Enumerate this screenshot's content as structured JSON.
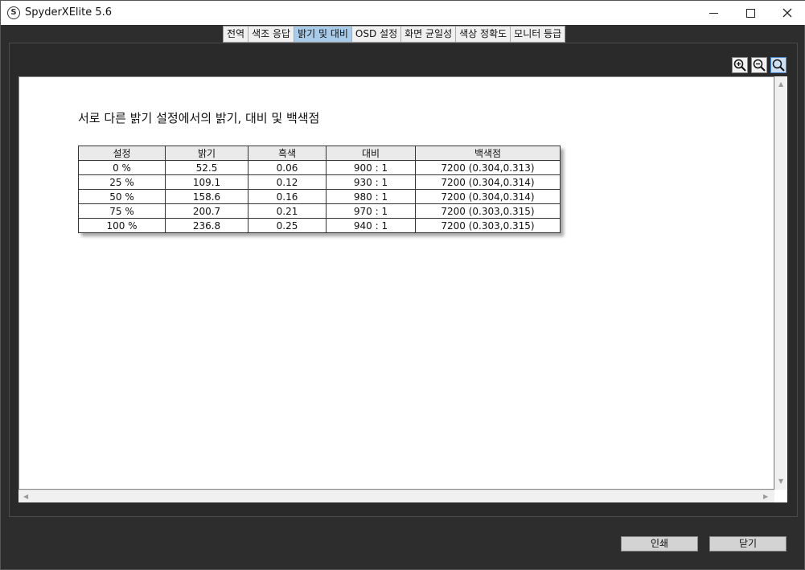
{
  "window": {
    "title": "SpyderXElite 5.6",
    "icon_letter": "S"
  },
  "tabs": [
    {
      "label": "전역",
      "active": false
    },
    {
      "label": "색조 응답",
      "active": false
    },
    {
      "label": "밝기 및 대비",
      "active": true
    },
    {
      "label": "OSD 설정",
      "active": false
    },
    {
      "label": "화면 균일성",
      "active": false
    },
    {
      "label": "색상 정확도",
      "active": false
    },
    {
      "label": "모니터 등급",
      "active": false
    }
  ],
  "zoom_tools": [
    "zoom-in-icon",
    "zoom-out-icon",
    "zoom-fit-icon"
  ],
  "report": {
    "title": "서로 다른 밝기 설정에서의 밝기, 대비 및 백색점",
    "columns": [
      "설정",
      "밝기",
      "흑색",
      "대비",
      "백색점"
    ],
    "rows": [
      [
        "0 %",
        "52.5",
        "0.06",
        "900 : 1",
        "7200 (0.304,0.313)"
      ],
      [
        "25 %",
        "109.1",
        "0.12",
        "930 : 1",
        "7200 (0.304,0.314)"
      ],
      [
        "50 %",
        "158.6",
        "0.16",
        "980 : 1",
        "7200 (0.304,0.314)"
      ],
      [
        "75 %",
        "200.7",
        "0.21",
        "970 : 1",
        "7200 (0.303,0.315)"
      ],
      [
        "100 %",
        "236.8",
        "0.25",
        "940 : 1",
        "7200 (0.303,0.315)"
      ]
    ]
  },
  "buttons": {
    "print": "인쇄",
    "close": "닫기"
  },
  "colors": {
    "active_tab": "#a9cbea",
    "background": "#2d2d2d"
  }
}
